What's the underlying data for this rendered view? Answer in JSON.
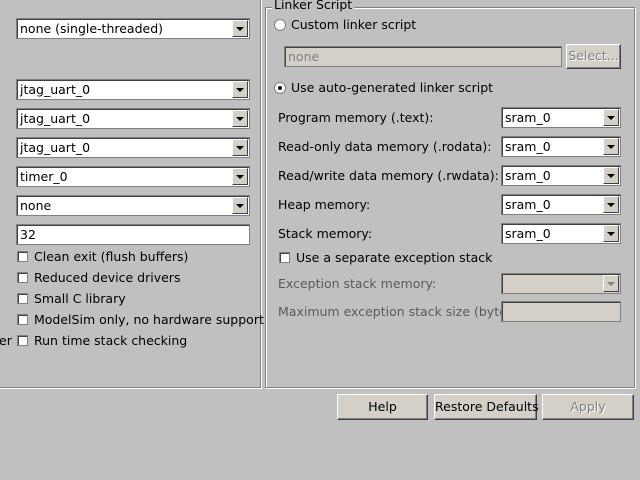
{
  "left_panel": {
    "thread_mode": "none (single-threaded)",
    "stdin": "jtag_uart_0",
    "stdout": "jtag_uart_0",
    "stderr": "jtag_uart_0",
    "sys_clk_timer": "timer_0",
    "timestamp_timer": "none",
    "max_file_descriptors": "32",
    "checkboxes": [
      {
        "label": "Clean exit (flush buffers)",
        "checked": false
      },
      {
        "label": "Reduced device drivers",
        "checked": false
      },
      {
        "label": "Small C library",
        "checked": false
      },
      {
        "label": "ModelSim only, no hardware support",
        "checked": false
      },
      {
        "label": "Run time stack checking",
        "checked": false
      }
    ],
    "cut_label_fragment": "er"
  },
  "linker_script": {
    "group_title": "Linker Script",
    "custom_option_label": "Custom linker script",
    "custom_path_placeholder": "none",
    "select_button": "Select...",
    "auto_option_label": "Use auto-generated linker script",
    "selected_option": "auto",
    "rows": [
      {
        "label": "Program memory (.text):",
        "value": "sram_0"
      },
      {
        "label": "Read-only data memory (.rodata):",
        "value": "sram_0"
      },
      {
        "label": "Read/write data memory (.rwdata):",
        "value": "sram_0"
      },
      {
        "label": "Heap memory:",
        "value": "sram_0"
      },
      {
        "label": "Stack memory:",
        "value": "sram_0"
      }
    ],
    "separate_exception_stack_label": "Use a separate exception stack",
    "exception_stack_memory_label": "Exception stack memory:",
    "exception_stack_memory_value": "",
    "max_exception_stack_label": "Maximum exception stack size (bytes):",
    "max_exception_stack_value": ""
  },
  "buttons": {
    "help": "Help",
    "restore_defaults": "Restore Defaults",
    "apply": "Apply"
  }
}
